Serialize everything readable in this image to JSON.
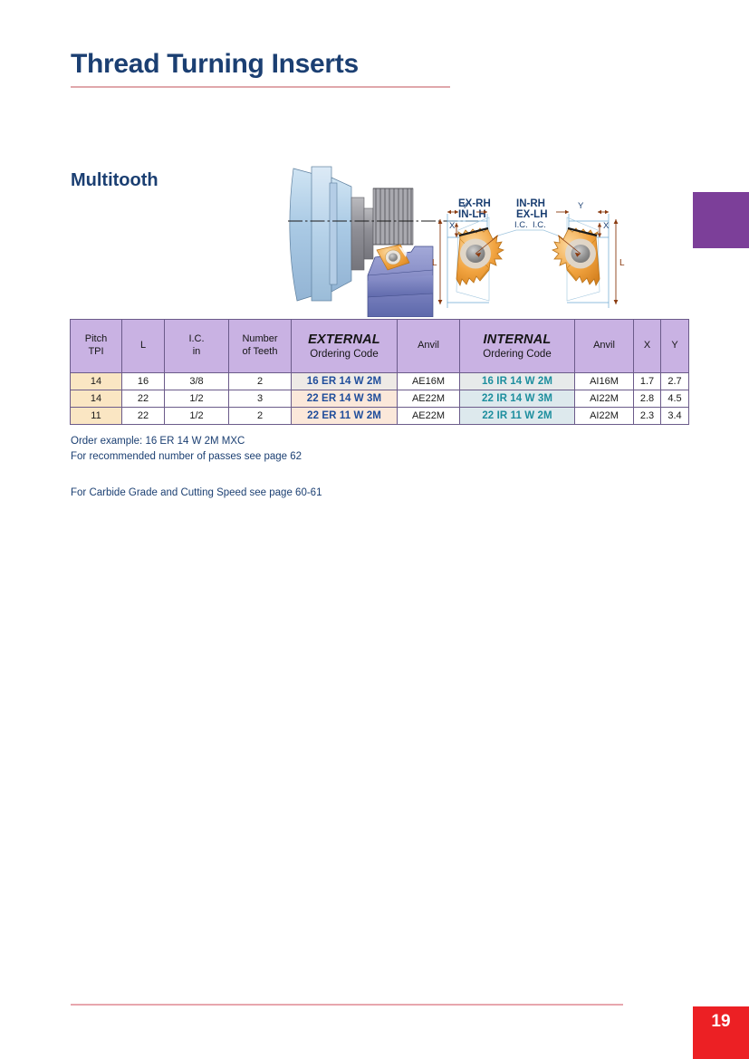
{
  "page": {
    "title": "Thread Turning Inserts",
    "section_heading": "Multitooth",
    "page_number": "19",
    "accent_red": "#ec2024",
    "title_blue": "#1b3f72",
    "header_purple": "#c9b2e3",
    "tab_purple": "#7c3f99",
    "rule_pink": "#e0a7ab"
  },
  "diagram": {
    "labels": {
      "ex_rh": "EX-RH",
      "in_lh": "IN-LH",
      "in_rh": "IN-RH",
      "ex_lh": "EX-LH",
      "ic_left": "I.C.",
      "ic_right": "I.C.",
      "dim_x_left": "X",
      "dim_y_left": "Y",
      "dim_l_left": "L",
      "dim_x_right": "X",
      "dim_y_right": "Y",
      "dim_l_right": "L"
    },
    "colors": {
      "insert": "#f0a03c",
      "insert_light": "#fbd9a0",
      "hole": "#8a8a8a",
      "dimension": "#8a3b10",
      "guide": "#6aa6d0",
      "holder": "#8b92c8",
      "chuck": "#b9d4ea"
    }
  },
  "table": {
    "columns": [
      {
        "key": "pitch",
        "label_line1": "Pitch",
        "label_line2": "TPI"
      },
      {
        "key": "l",
        "label_line1": "L",
        "label_line2": ""
      },
      {
        "key": "ic",
        "label_line1": "I.C.",
        "label_line2": "in"
      },
      {
        "key": "teeth",
        "label_line1": "Number",
        "label_line2": "of Teeth"
      },
      {
        "key": "extc",
        "label_line1": "EXTERNAL",
        "label_line2": "Ordering Code"
      },
      {
        "key": "anvil1",
        "label_line1": "Anvil",
        "label_line2": ""
      },
      {
        "key": "intc",
        "label_line1": "INTERNAL",
        "label_line2": "Ordering Code"
      },
      {
        "key": "anvil2",
        "label_line1": "Anvil",
        "label_line2": ""
      },
      {
        "key": "x",
        "label_line1": "X",
        "label_line2": ""
      },
      {
        "key": "y",
        "label_line1": "Y",
        "label_line2": ""
      }
    ],
    "rows": [
      {
        "pitch": "14",
        "l": "16",
        "ic": "3/8",
        "teeth": "2",
        "ext_code": "16 ER 14 W 2M",
        "anvil_ext": "AE16M",
        "int_code": "16 IR 14 W 2M",
        "anvil_int": "AI16M",
        "x": "1.7",
        "y": "2.7"
      },
      {
        "pitch": "14",
        "l": "22",
        "ic": "1/2",
        "teeth": "3",
        "ext_code": "22 ER 14 W 3M",
        "anvil_ext": "AE22M",
        "int_code": "22 IR 14 W 3M",
        "anvil_int": "AI22M",
        "x": "2.8",
        "y": "4.5"
      },
      {
        "pitch": "11",
        "l": "22",
        "ic": "1/2",
        "teeth": "2",
        "ext_code": "22 ER 11 W 2M",
        "anvil_ext": "AE22M",
        "int_code": "22 IR 11 W 2M",
        "anvil_int": "AI22M",
        "x": "2.3",
        "y": "3.4"
      }
    ]
  },
  "notes": {
    "order_example": "Order example: 16 ER 14 W 2M MXC",
    "passes": "For recommended number of passes see page 62",
    "carbide": "For Carbide Grade and Cutting Speed see page 60-61"
  }
}
